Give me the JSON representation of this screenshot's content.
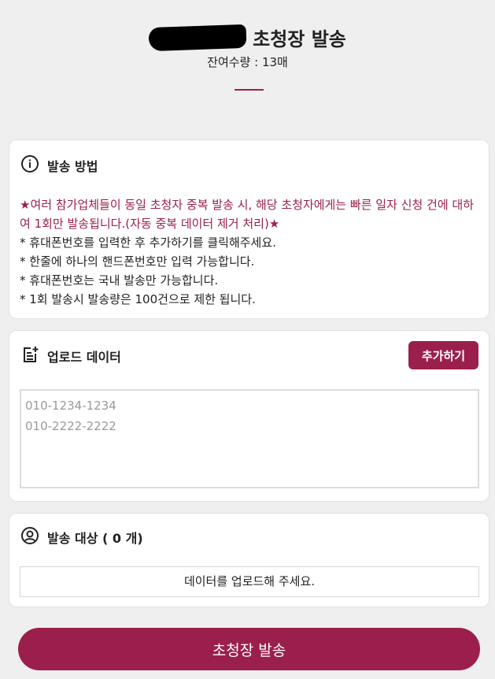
{
  "header": {
    "title": "초청장 발송",
    "remaining": "잔여수량 : 13매"
  },
  "method": {
    "title": "발송 방법",
    "notice": "★여러 참가업체들이 동일 초청자 중복 발송 시, 해당 초청자에게는 빠른 일자 신청 건에 대하여 1회만 발송됩니다.(자동 중복 데이터 제거 처리)★",
    "lines": [
      "* 휴대폰번호를 입력한 후 추가하기를 클릭해주세요.",
      "* 한줄에 하나의 핸드폰번호만 입력 가능합니다.",
      "* 휴대폰번호는 국내 발송만 가능합니다.",
      "* 1회 발송시 발송량은 100건으로 제한 됩니다."
    ]
  },
  "upload": {
    "title": "업로드 데이터",
    "add_label": "추가하기",
    "placeholder": "010-1234-1234\n010-2222-2222"
  },
  "target": {
    "title": "발송 대상 ( 0 개)",
    "empty_message": "데이터를 업로드해 주세요."
  },
  "send_label": "초청장 발송",
  "colors": {
    "accent": "#9b1f4c",
    "background": "#efefef"
  },
  "icons": {
    "method": "info-circle-icon",
    "upload": "document-add-icon",
    "target": "user-circle-icon"
  }
}
